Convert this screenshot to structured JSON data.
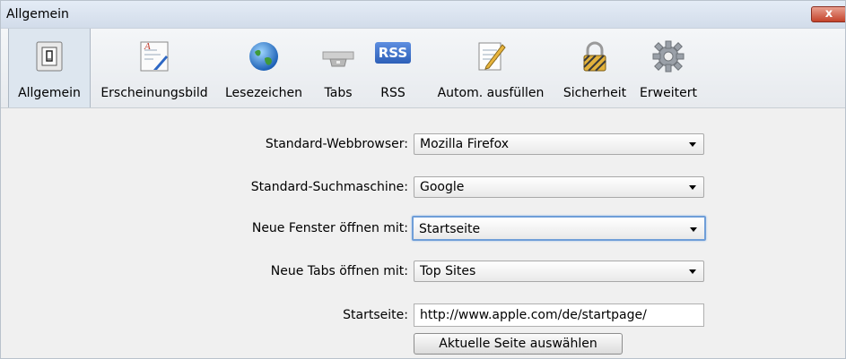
{
  "window": {
    "title": "Allgemein",
    "close_label": "x"
  },
  "toolbar": {
    "items": [
      {
        "label": "Allgemein",
        "icon": "switch-icon",
        "active": true
      },
      {
        "label": "Erscheinungsbild",
        "icon": "appearance-icon"
      },
      {
        "label": "Lesezeichen",
        "icon": "globe-icon"
      },
      {
        "label": "Tabs",
        "icon": "tabs-icon"
      },
      {
        "label": "RSS",
        "icon": "rss-icon",
        "badge": "RSS"
      },
      {
        "label": "Autom. ausfüllen",
        "icon": "autofill-pencil-icon"
      },
      {
        "label": "Sicherheit",
        "icon": "lock-icon"
      },
      {
        "label": "Erweitert",
        "icon": "gear-icon"
      }
    ]
  },
  "form": {
    "default_browser": {
      "label": "Standard-Webbrowser:",
      "value": "Mozilla Firefox"
    },
    "default_search": {
      "label": "Standard-Suchmaschine:",
      "value": "Google"
    },
    "new_window": {
      "label": "Neue Fenster öffnen mit:",
      "value": "Startseite"
    },
    "new_tabs": {
      "label": "Neue Tabs öffnen mit:",
      "value": "Top Sites"
    },
    "homepage": {
      "label": "Startseite:",
      "value": "http://www.apple.com/de/startpage/"
    },
    "set_current_button": "Aktuelle Seite auswählen"
  },
  "colors": {
    "titlebar": "#d8e2ee",
    "close": "#c4432b",
    "focus": "#6f9ed8",
    "rss": "#3b6fc2"
  }
}
